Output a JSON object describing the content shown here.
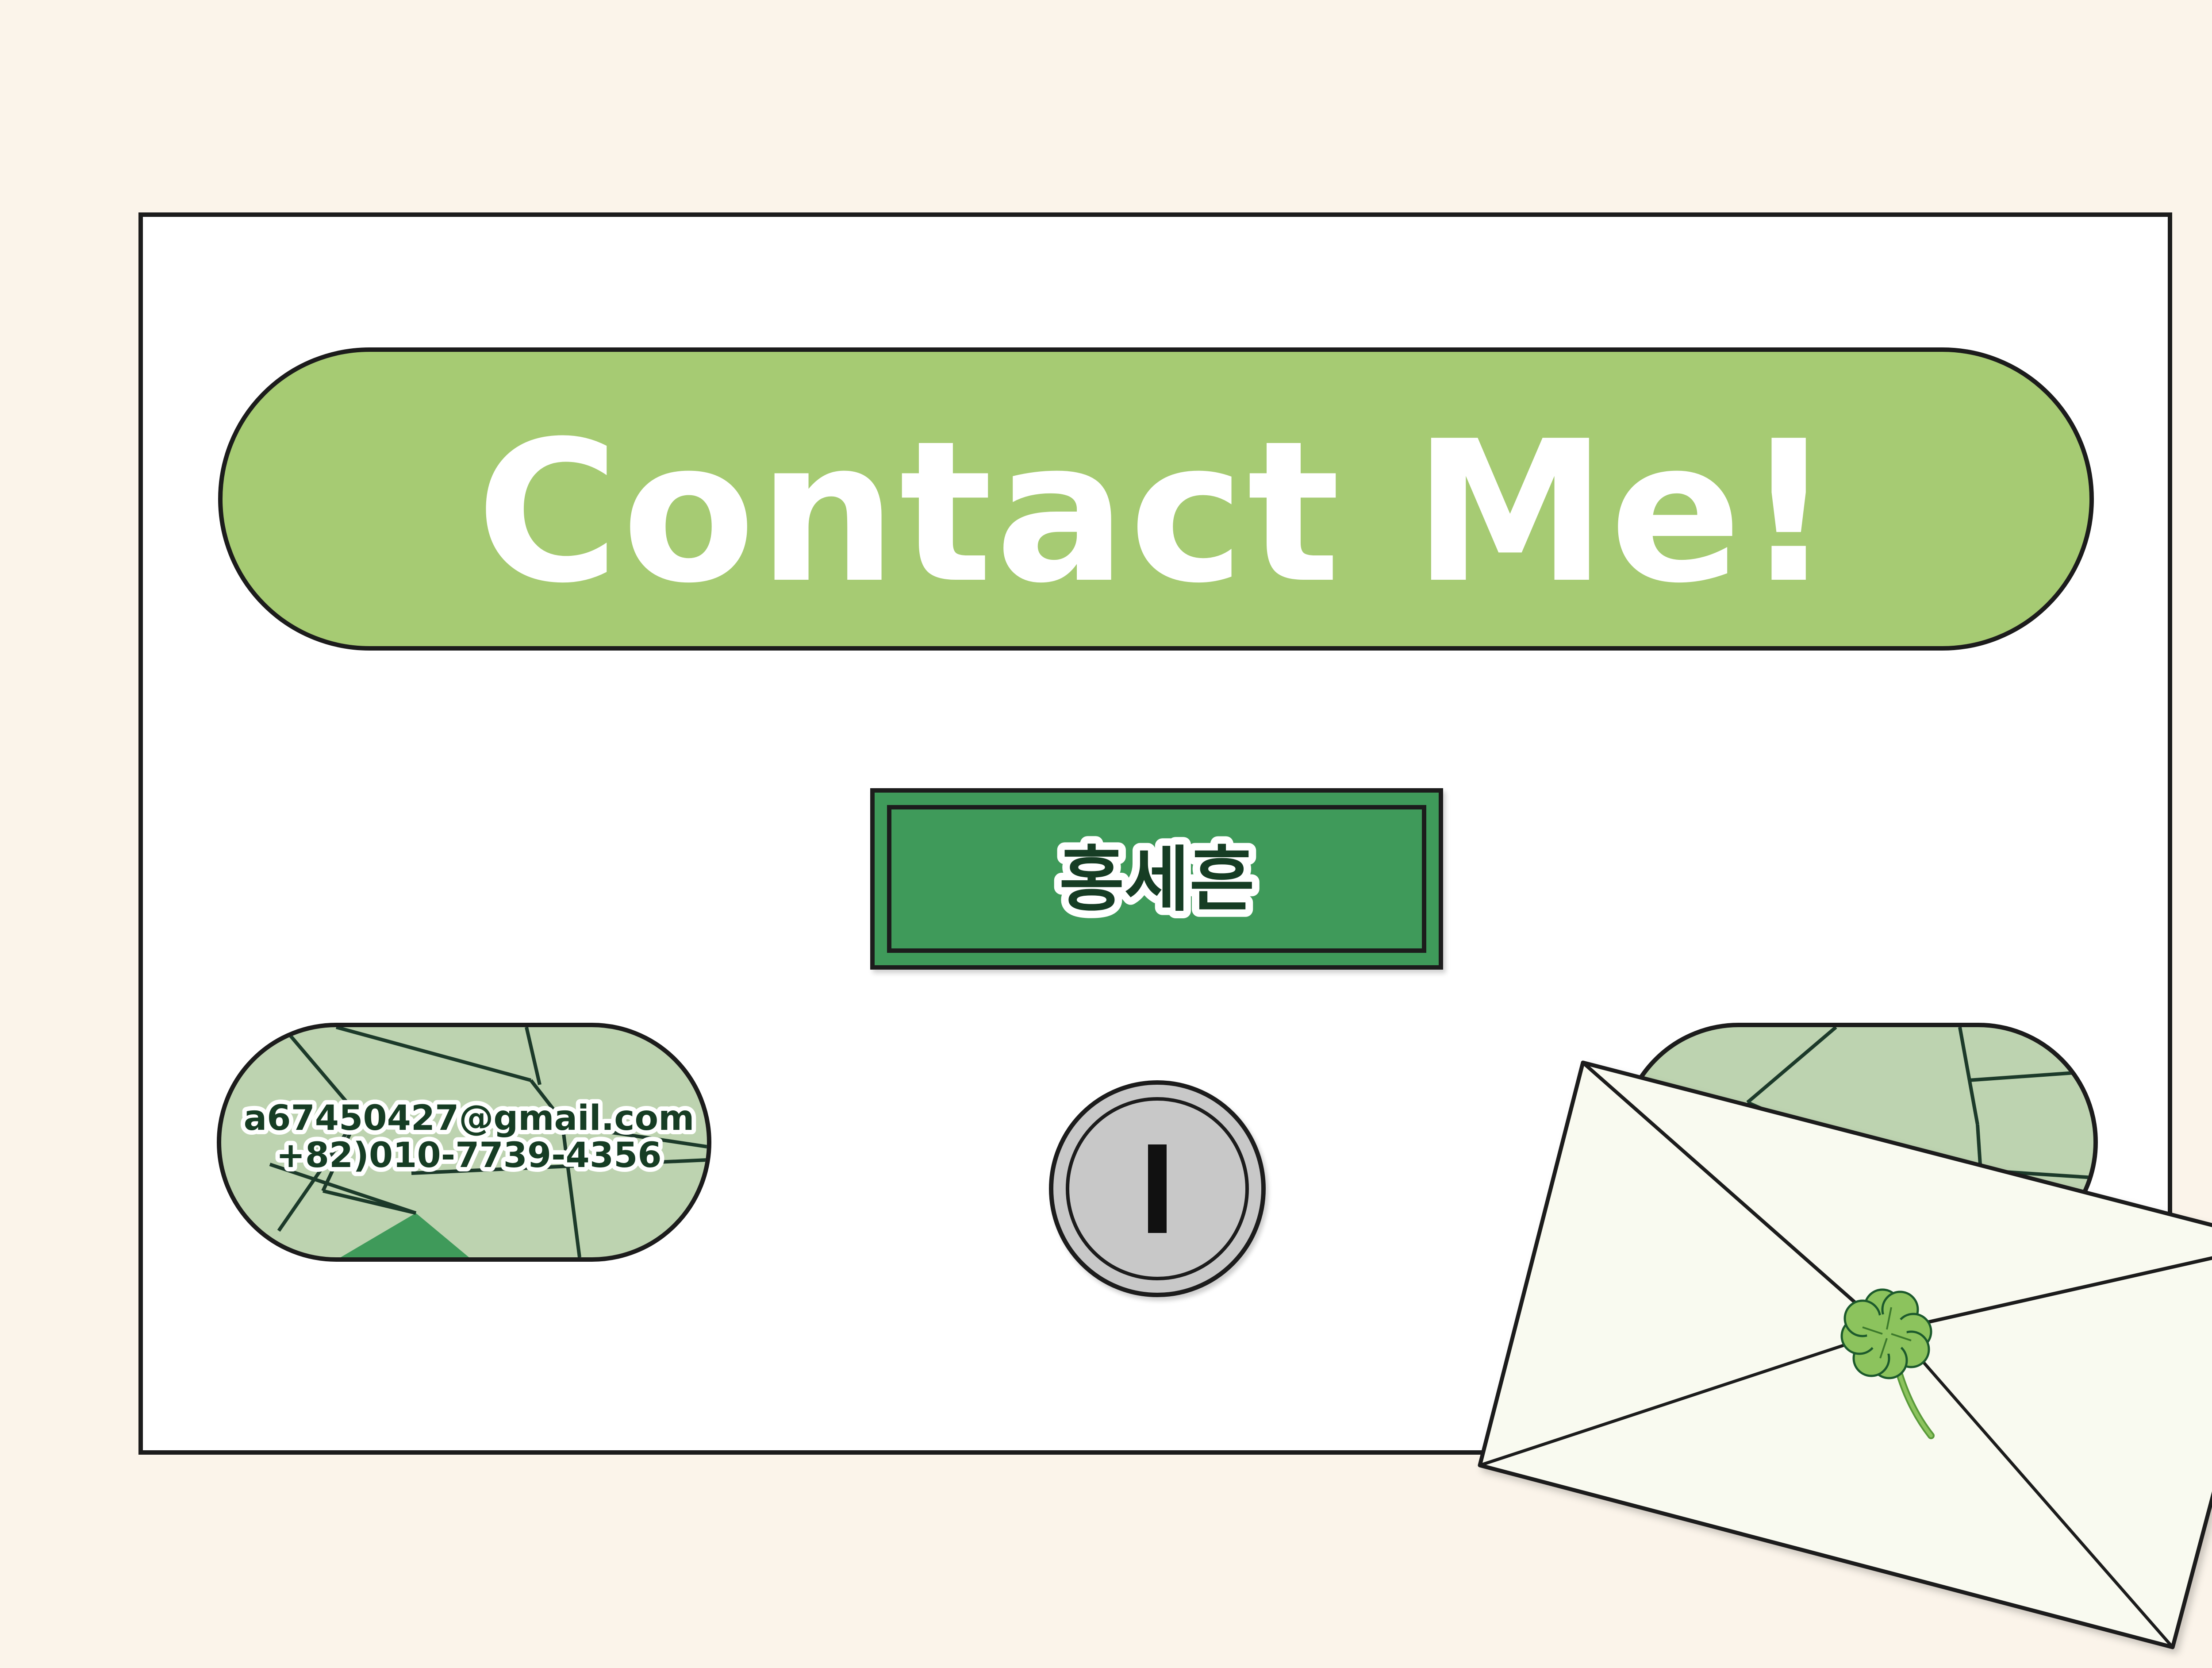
{
  "title": {
    "text": "Contact Me!"
  },
  "name_badge": {
    "text": "홍세흔"
  },
  "contact": {
    "email": "a67450427@gmail.com",
    "phone": "+82)010-7739-4356"
  },
  "colors": {
    "background": "#fbf4ea",
    "card": "#ffffff",
    "title_pill": "#a6cb73",
    "name_button": "#3f9a5a",
    "pill_light": "#bdd3b0",
    "pill_dark": "#3f9a5a",
    "outline": "#1c1c1c",
    "coin": "#c8c8c8",
    "envelope": "#f9faf0",
    "clover": "#8cc35d"
  },
  "icons": {
    "coin": "coin-icon",
    "envelope": "envelope-icon",
    "clover": "clover-icon"
  }
}
